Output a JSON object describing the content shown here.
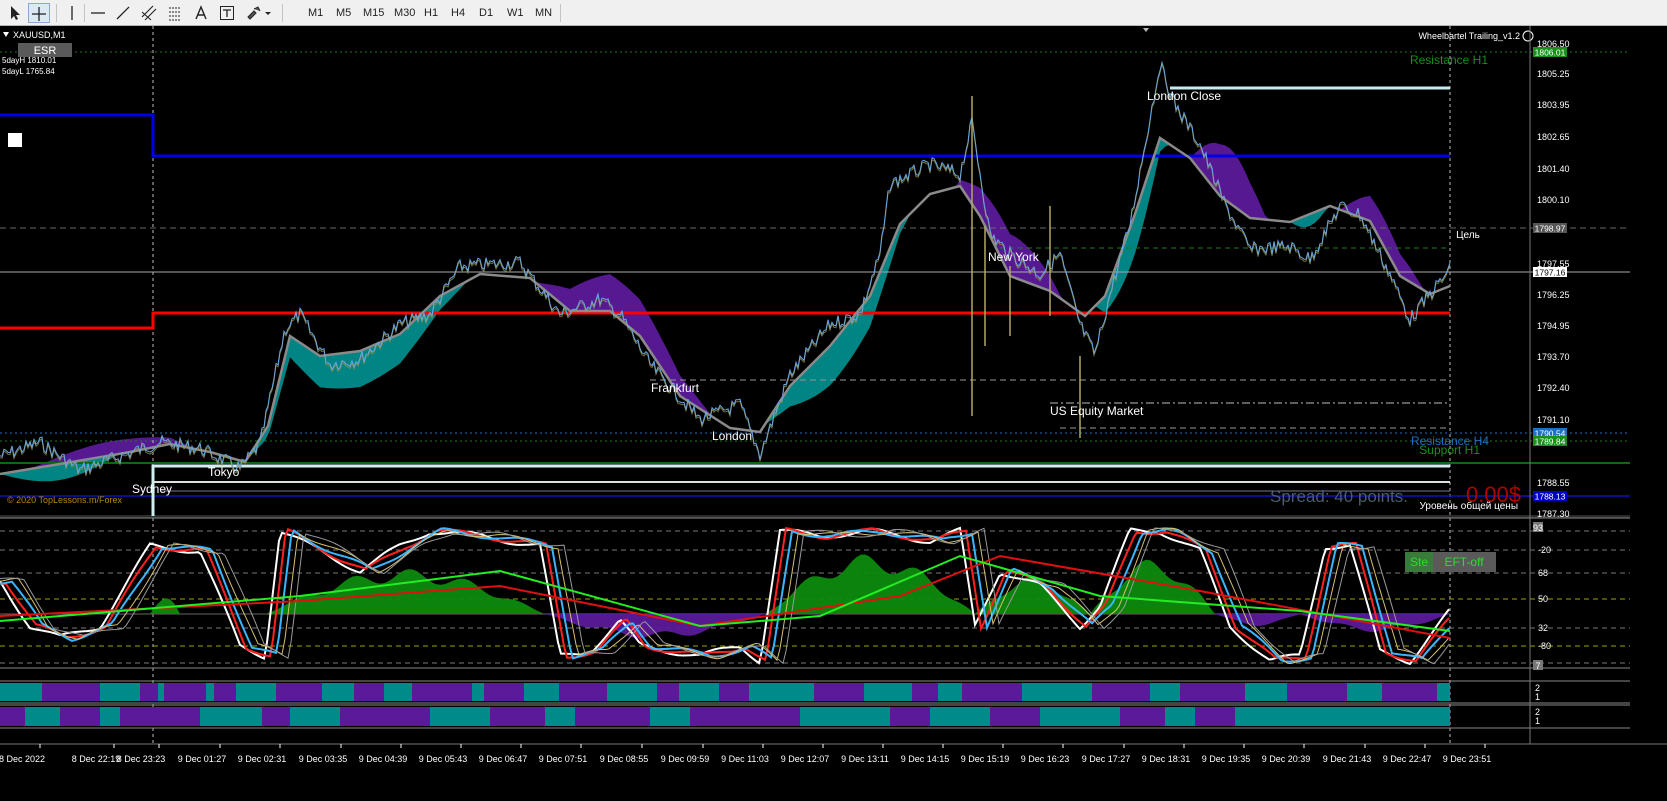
{
  "toolbar": {
    "timeframes": [
      "M1",
      "M5",
      "M15",
      "M30",
      "H1",
      "H4",
      "D1",
      "W1",
      "MN"
    ]
  },
  "chart": {
    "symbol": "XAUUSD,M1",
    "indicator_title": "Wheelbartel Trailing_v1.2",
    "button_label": "ESR",
    "day_high": "5dayH 1810.01",
    "day_low": "5dayL 1765.84",
    "copyright": "© 2020 TopLessons.m/Forex",
    "spread": "Spread: 40 points.",
    "profit": "0.00$",
    "avg_price_label": "Уровень общей цены",
    "target_label": "Цель",
    "resistance_h1": "Resistance H1",
    "resistance_h4": "Resistance H4",
    "support_h1": "Support H1",
    "ste_button": "Ste",
    "eft_button": "EFT-off",
    "sessions": {
      "sydney": "Sydney",
      "tokyo": "Tokyo",
      "frankfurt": "Frankfurt",
      "london": "London",
      "new_york": "New York",
      "us_equity": "US Equity Market",
      "london_close": "London Close"
    }
  },
  "price_axis": {
    "ticks": [
      "1806.50",
      "1805.25",
      "1803.95",
      "1802.65",
      "1801.40",
      "1800.10",
      "1797.55",
      "1796.25",
      "1794.95",
      "1793.70",
      "1792.40",
      "1791.10",
      "1788.55",
      "1787.30"
    ],
    "tags": [
      "1806.01",
      "1798.97",
      "1797.16",
      "1790.54",
      "1789.84",
      "1788.13"
    ]
  },
  "osc_axis": {
    "ticks": [
      "93",
      "-20",
      "68",
      "50",
      "32",
      "-80",
      "7"
    ]
  },
  "bar_axis": {
    "ticks": [
      "2",
      "1"
    ]
  },
  "time_axis": {
    "labels": [
      "8 Dec 2022",
      "8 Dec 22:19",
      "8 Dec 23:23",
      "9 Dec 01:27",
      "9 Dec 02:31",
      "9 Dec 03:35",
      "9 Dec 04:39",
      "9 Dec 05:43",
      "9 Dec 06:47",
      "9 Dec 07:51",
      "9 Dec 08:55",
      "9 Dec 09:59",
      "9 Dec 11:03",
      "9 Dec 12:07",
      "9 Dec 13:11",
      "9 Dec 14:15",
      "9 Dec 15:19",
      "9 Dec 16:23",
      "9 Dec 17:27",
      "9 Dec 18:31",
      "9 Dec 19:35",
      "9 Dec 20:39",
      "9 Dec 21:43",
      "9 Dec 22:47",
      "9 Dec 23:51"
    ]
  },
  "colors": {
    "bull_cloud": "#008b8b",
    "bear_cloud": "#5b1a9a",
    "price": "#6aa8e0",
    "red_level": "#ff0000",
    "blue_level": "#0000e6",
    "osc_fill": "#0d8a0d"
  }
}
